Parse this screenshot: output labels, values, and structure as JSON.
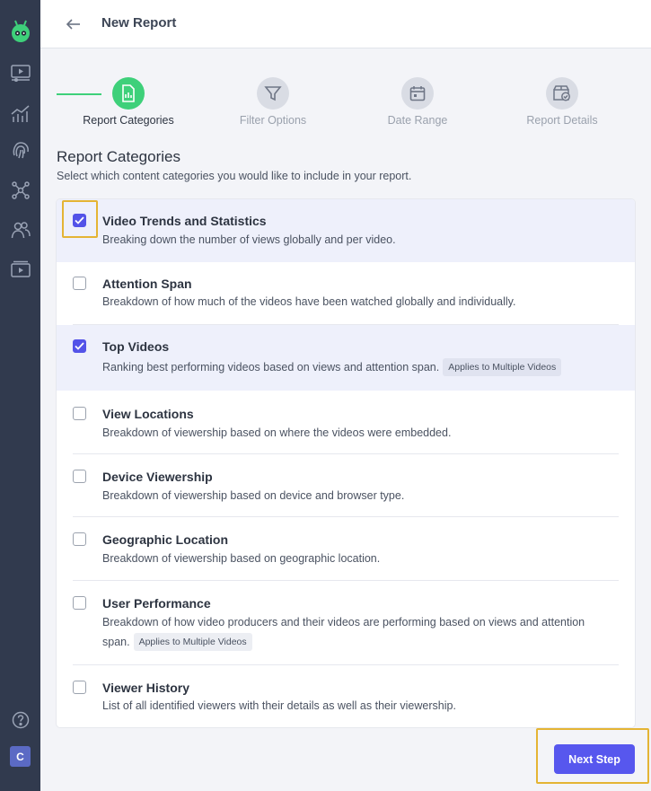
{
  "header": {
    "title": "New Report"
  },
  "colors": {
    "accent": "#5757ee",
    "step_active": "#3ed07a",
    "sidebar": "#313a4e",
    "highlight": "#e4b434"
  },
  "sidebar": {
    "logo_icon": "robot-logo-icon",
    "items": [
      {
        "icon": "video-player-icon"
      },
      {
        "icon": "analytics-chart-icon"
      },
      {
        "icon": "fingerprint-icon"
      },
      {
        "icon": "network-nodes-icon"
      },
      {
        "icon": "users-icon"
      },
      {
        "icon": "video-library-icon"
      }
    ],
    "help_icon": "help-circle-icon",
    "avatar_initial": "C"
  },
  "stepper": {
    "steps": [
      {
        "label": "Report Categories",
        "icon": "report-document-icon",
        "active": true
      },
      {
        "label": "Filter Options",
        "icon": "filter-funnel-icon",
        "active": false
      },
      {
        "label": "Date Range",
        "icon": "calendar-icon",
        "active": false
      },
      {
        "label": "Report Details",
        "icon": "report-details-icon",
        "active": false
      }
    ]
  },
  "section": {
    "title": "Report Categories",
    "subtitle": "Select which content categories you would like to include in your report."
  },
  "categories": [
    {
      "title": "Video Trends and Statistics",
      "description": "Breaking down the number of views globally and per video.",
      "checked": true,
      "badge": ""
    },
    {
      "title": "Attention Span",
      "description": "Breakdown of how much of the videos have been watched globally and individually.",
      "checked": false,
      "badge": ""
    },
    {
      "title": "Top Videos",
      "description": "Ranking best performing videos based on views and attention span.",
      "checked": true,
      "badge": "Applies to Multiple Videos"
    },
    {
      "title": "View Locations",
      "description": "Breakdown of viewership based on where the videos were embedded.",
      "checked": false,
      "badge": ""
    },
    {
      "title": "Device Viewership",
      "description": "Breakdown of viewership based on device and browser type.",
      "checked": false,
      "badge": ""
    },
    {
      "title": "Geographic Location",
      "description": "Breakdown of viewership based on geographic location.",
      "checked": false,
      "badge": ""
    },
    {
      "title": "User Performance",
      "description": "Breakdown of how video producers and their videos are performing based on views and attention span.",
      "checked": false,
      "badge": "Applies to Multiple Videos"
    },
    {
      "title": "Viewer History",
      "description": "List of all identified viewers with their details as well as their viewership.",
      "checked": false,
      "badge": ""
    }
  ],
  "footer": {
    "next_label": "Next Step"
  }
}
